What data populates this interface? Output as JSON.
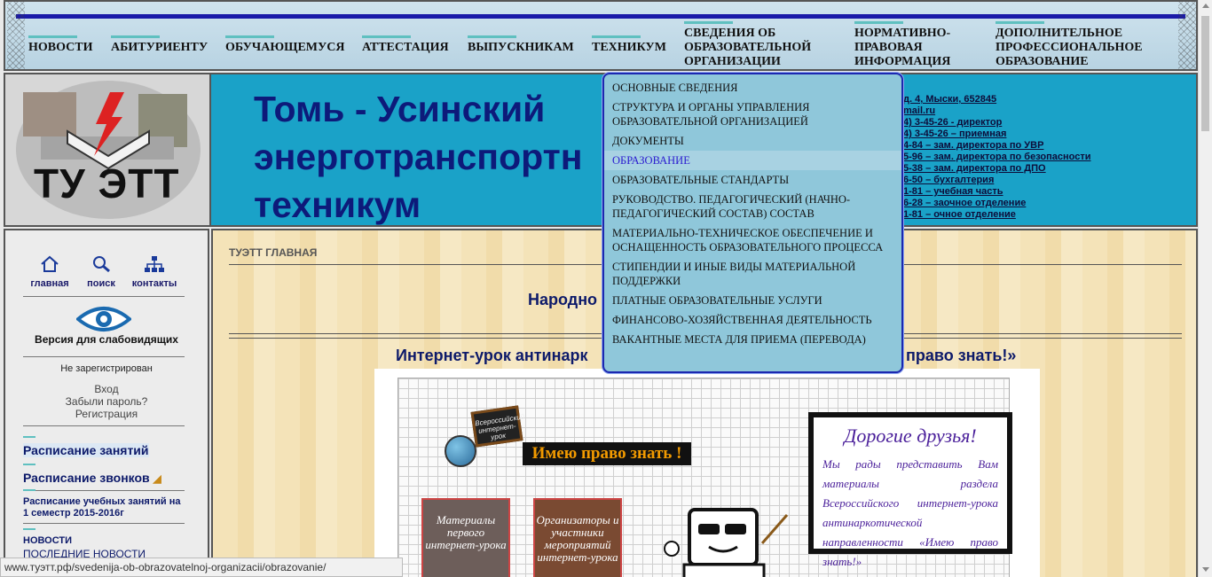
{
  "topnav": {
    "items": [
      "НОВОСТИ",
      "АБИТУРИЕНТУ",
      "ОБУЧАЮЩЕМУСЯ",
      "АТТЕСТАЦИЯ",
      "ВЫПУСКНИКАМ",
      "ТЕХНИКУМ",
      "СВЕДЕНИЯ ОБ ОБРАЗОВАТЕЛЬНОЙ ОРГАНИЗАЦИИ",
      "НОРМАТИВНО-ПРАВОВАЯ ИНФОРМАЦИЯ",
      "ДОПОЛНИТЕЛЬНОЕ ПРОФЕССИОНАЛЬНОЕ ОБРАЗОВАНИЕ"
    ]
  },
  "header": {
    "logo_text": "ТУ ЭТТ",
    "title": "Томь - Усинский\nэнерготранспортн\nтехникум",
    "contacts": [
      "д. 4, Мыски, 652845",
      "mail.ru",
      "4) 3-45-26 - директор",
      "4) 3-45-26 – приемная",
      "4-84 – зам. директора по УВР",
      "5-96 – зам. директора по безопасности",
      "5-38 – зам. директора по ДПО",
      "6-50 – бухгалтерия",
      "1-81 – учебная часть",
      "6-28 – заочное отделение",
      "1-81 – очное отделение"
    ]
  },
  "sidebar": {
    "quick_links": [
      "главная",
      "поиск",
      "контакты"
    ],
    "low_vision": "Версия для слабовидящих",
    "not_registered": "Не зарегистрирован",
    "login": "Вход",
    "forgot": "Забыли пароль?",
    "register": "Регистрация",
    "schedule_classes": "Расписание  занятий",
    "schedule_bells": "Расписание звонков",
    "schedule_semester": "Расписание учебных занятий на 1 семестр 2015-2016г",
    "news_label": "НОВОСТИ",
    "latest_news": "ПОСЛЕДНИЕ НОВОСТИ"
  },
  "main": {
    "breadcrumb": "ТУЭТТ ГЛАВНАЯ",
    "heading1": "Народно",
    "heading2_start": "Интернет-урок антинарк",
    "heading2_end": "право знать!»",
    "chalkboard": "Всероссийский интернет-урок",
    "slogan": "Имею право знать !",
    "card1": "Материалы первого интернет-урока",
    "card2": "Организаторы и участники мероприятий интернет-урока",
    "board_title": "Дорогие друзья!",
    "board_text": "Мы рады представить Вам материалы раздела Всероссийского интернет-урока антинаркотической направленности «Имею право знать!»"
  },
  "dropdown": {
    "items": [
      "ОСНОВНЫЕ СВЕДЕНИЯ",
      "СТРУКТУРА И ОРГАНЫ УПРАВЛЕНИЯ ОБРАЗОВАТЕЛЬНОЙ ОРГАНИЗАЦИЕЙ",
      "ДОКУМЕНТЫ",
      "ОБРАЗОВАНИЕ",
      "ОБРАЗОВАТЕЛЬНЫЕ СТАНДАРТЫ",
      "РУКОВОДСТВО. ПЕДАГОГИЧЕСКИЙ (НАЧНО-ПЕДАГОГИЧЕСКИЙ СОСТАВ) СОСТАВ",
      "МАТЕРИАЛЬНО-ТЕХНИЧЕСКОЕ ОБЕСПЕЧЕНИЕ И ОСНАЩЕННОСТЬ ОБРАЗОВАТЕЛЬНОГО ПРОЦЕССА",
      "СТИПЕНДИИ И ИНЫЕ ВИДЫ МАТЕРИАЛЬНОЙ ПОДДЕРЖКИ",
      "ПЛАТНЫЕ ОБРАЗОВАТЕЛЬНЫЕ УСЛУГИ",
      "ФИНАНСОВО-ХОЗЯЙСТВЕННАЯ ДЕЯТЕЛЬНОСТЬ",
      "ВАКАНТНЫЕ МЕСТА ДЛЯ ПРИЕМА (ПЕРЕВОДА)"
    ],
    "active_item": "ОБРАЗОВАНИЕ"
  },
  "statusbar": {
    "url": "www.туэтт.рф/svedenija-ob-obrazovatelnoj-organizacii/obrazovanie/"
  },
  "colors": {
    "header_bg": "#1aa2c8",
    "title": "#0d1a7a",
    "nav_bar": "#1a1aa8",
    "dropdown_bg": "#8fc7da",
    "dropdown_border": "#1c28b0",
    "dropdown_active_text": "#2a1ad0"
  }
}
